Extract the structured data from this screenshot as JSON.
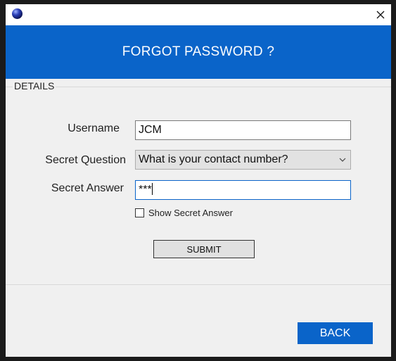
{
  "window": {
    "close_icon": "close-icon",
    "app_icon": "app-orb-icon"
  },
  "banner": {
    "title": "FORGOT PASSWORD ?",
    "color": "#0a64c9"
  },
  "details": {
    "legend": "DETAILS",
    "username_label": "Username",
    "username_value": "JCM",
    "question_label": "Secret Question",
    "question_selected": "What is your contact number?",
    "answer_label": "Secret Answer",
    "answer_value": "***",
    "show_answer_label": "Show Secret Answer",
    "show_answer_checked": false,
    "submit_label": "SUBMIT"
  },
  "footer": {
    "back_label": "BACK"
  }
}
